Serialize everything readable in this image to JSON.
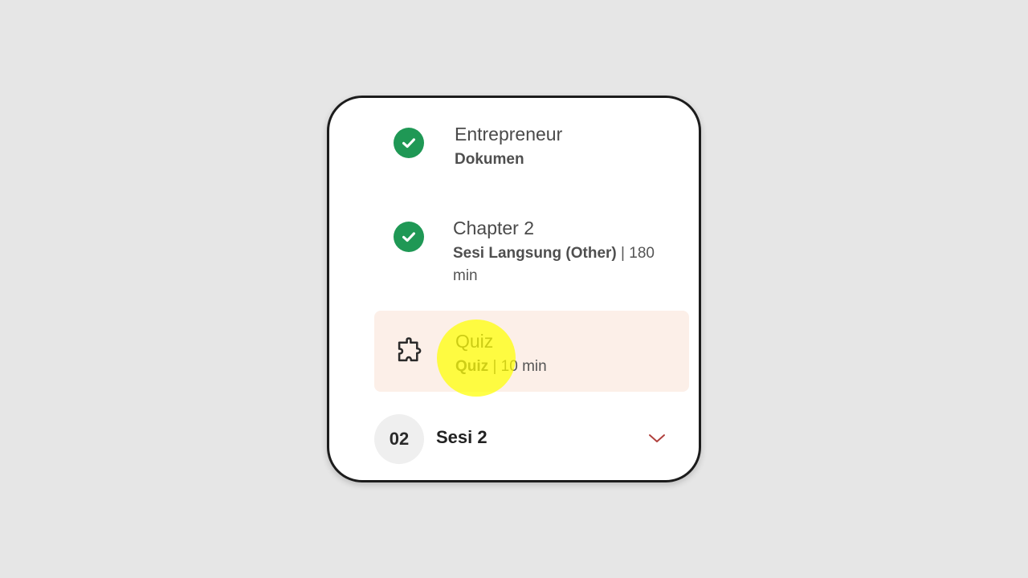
{
  "lessons": [
    {
      "title": "Entrepreneur",
      "type": "Dokumen",
      "duration": "",
      "icon": "check-circle-icon",
      "status": "completed"
    },
    {
      "title": "Chapter 2",
      "type": "Sesi Langsung (Other)",
      "duration": "180 min",
      "icon": "check-circle-icon",
      "status": "completed"
    },
    {
      "title": "Quiz",
      "type": "Quiz",
      "duration": "10 min",
      "icon": "puzzle-icon",
      "status": "active"
    }
  ],
  "separator": " | ",
  "session": {
    "number": "02",
    "label": "Sesi 2",
    "icon": "chevron-down-icon"
  },
  "colors": {
    "background": "#e6e6e6",
    "card": "#ffffff",
    "check_green": "#1f9855",
    "active_row_bg": "#fcefe8",
    "chevron": "#b0413e",
    "highlight": "#ffff00"
  }
}
